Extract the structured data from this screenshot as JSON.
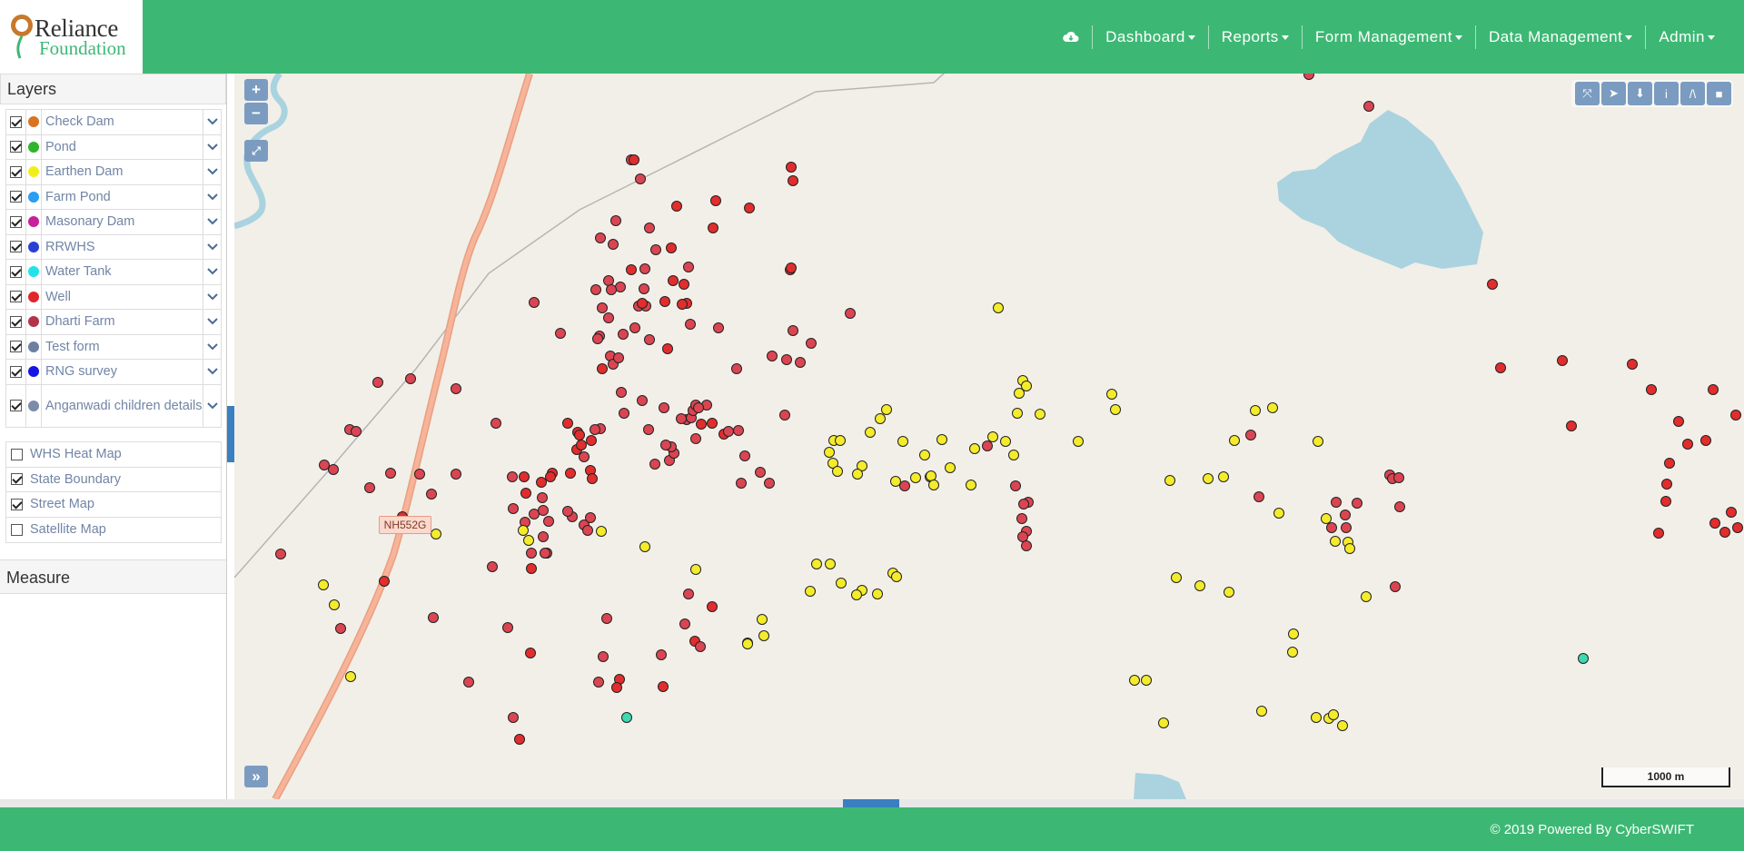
{
  "brand": {
    "line1": "Reliance",
    "line2": "Foundation"
  },
  "nav": {
    "cloud_icon": "cloud-download-icon",
    "items": [
      {
        "label": "Dashboard"
      },
      {
        "label": "Reports"
      },
      {
        "label": "Form Management"
      },
      {
        "label": "Data Management"
      },
      {
        "label": "Admin"
      }
    ]
  },
  "sidebar": {
    "layers_title": "Layers",
    "measure_title": "Measure",
    "layers": [
      {
        "label": "Check Dam",
        "color": "#d9731f",
        "checked": true
      },
      {
        "label": "Pond",
        "color": "#2fb52a",
        "checked": true
      },
      {
        "label": "Earthen Dam",
        "color": "#f2ee1c",
        "checked": true
      },
      {
        "label": "Farm Pond",
        "color": "#2a9df4",
        "checked": true
      },
      {
        "label": "Masonary Dam",
        "color": "#c81f9a",
        "checked": true
      },
      {
        "label": "RRWHS",
        "color": "#2b3fd6",
        "checked": true
      },
      {
        "label": "Water Tank",
        "color": "#22e3ea",
        "checked": true
      },
      {
        "label": "Well",
        "color": "#e0262b",
        "checked": true
      },
      {
        "label": "Dharti Farm",
        "color": "#b5324b",
        "checked": true
      },
      {
        "label": "Test form",
        "color": "#6d7fa0",
        "checked": true
      },
      {
        "label": "RNG survey",
        "color": "#1414e6",
        "checked": true
      },
      {
        "label": "Anganwadi children details",
        "color": "#7b8ba8",
        "checked": true
      }
    ],
    "base_layers": [
      {
        "label": "WHS Heat Map",
        "checked": false
      },
      {
        "label": "State Boundary",
        "checked": true
      },
      {
        "label": "Street Map",
        "checked": true
      },
      {
        "label": "Satellite Map",
        "checked": false
      }
    ]
  },
  "map": {
    "road_label": "NH552G",
    "scale_label": "1000 m",
    "zoom_in": "+",
    "zoom_out": "−",
    "expand": "»",
    "tools": [
      "fullscreen-icon",
      "select-pointer-icon",
      "download-icon",
      "info-icon",
      "line-draw-icon",
      "polygon-draw-icon"
    ]
  },
  "footer": {
    "text": "© 2019 Powered By CyberSWIFT"
  }
}
